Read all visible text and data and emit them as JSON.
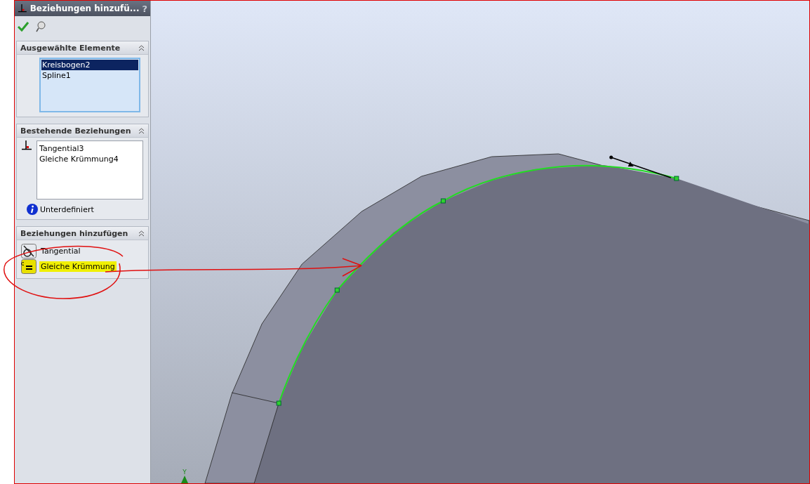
{
  "panel": {
    "title": "Beziehungen hinzufü...",
    "help": "?",
    "sections": [
      {
        "kind": "selection",
        "title": "Ausgewählte Elemente",
        "items": [
          {
            "label": "Kreisbogen2",
            "selected": true
          },
          {
            "label": "Spline1",
            "selected": false
          }
        ]
      },
      {
        "kind": "existing",
        "title": "Bestehende Beziehungen",
        "items": [
          {
            "label": "Tangential3"
          },
          {
            "label": "Gleiche Krümmung4"
          }
        ],
        "status": "Unterdefiniert"
      },
      {
        "kind": "add",
        "title": "Beziehungen hinzufügen",
        "items": [
          {
            "label": "Tangential",
            "kind": "tangent",
            "highlighted": false
          },
          {
            "label": "Gleiche Krümmung",
            "kind": "equal",
            "highlighted": true
          }
        ]
      }
    ]
  },
  "viewport": {
    "axis_label": "Y"
  }
}
